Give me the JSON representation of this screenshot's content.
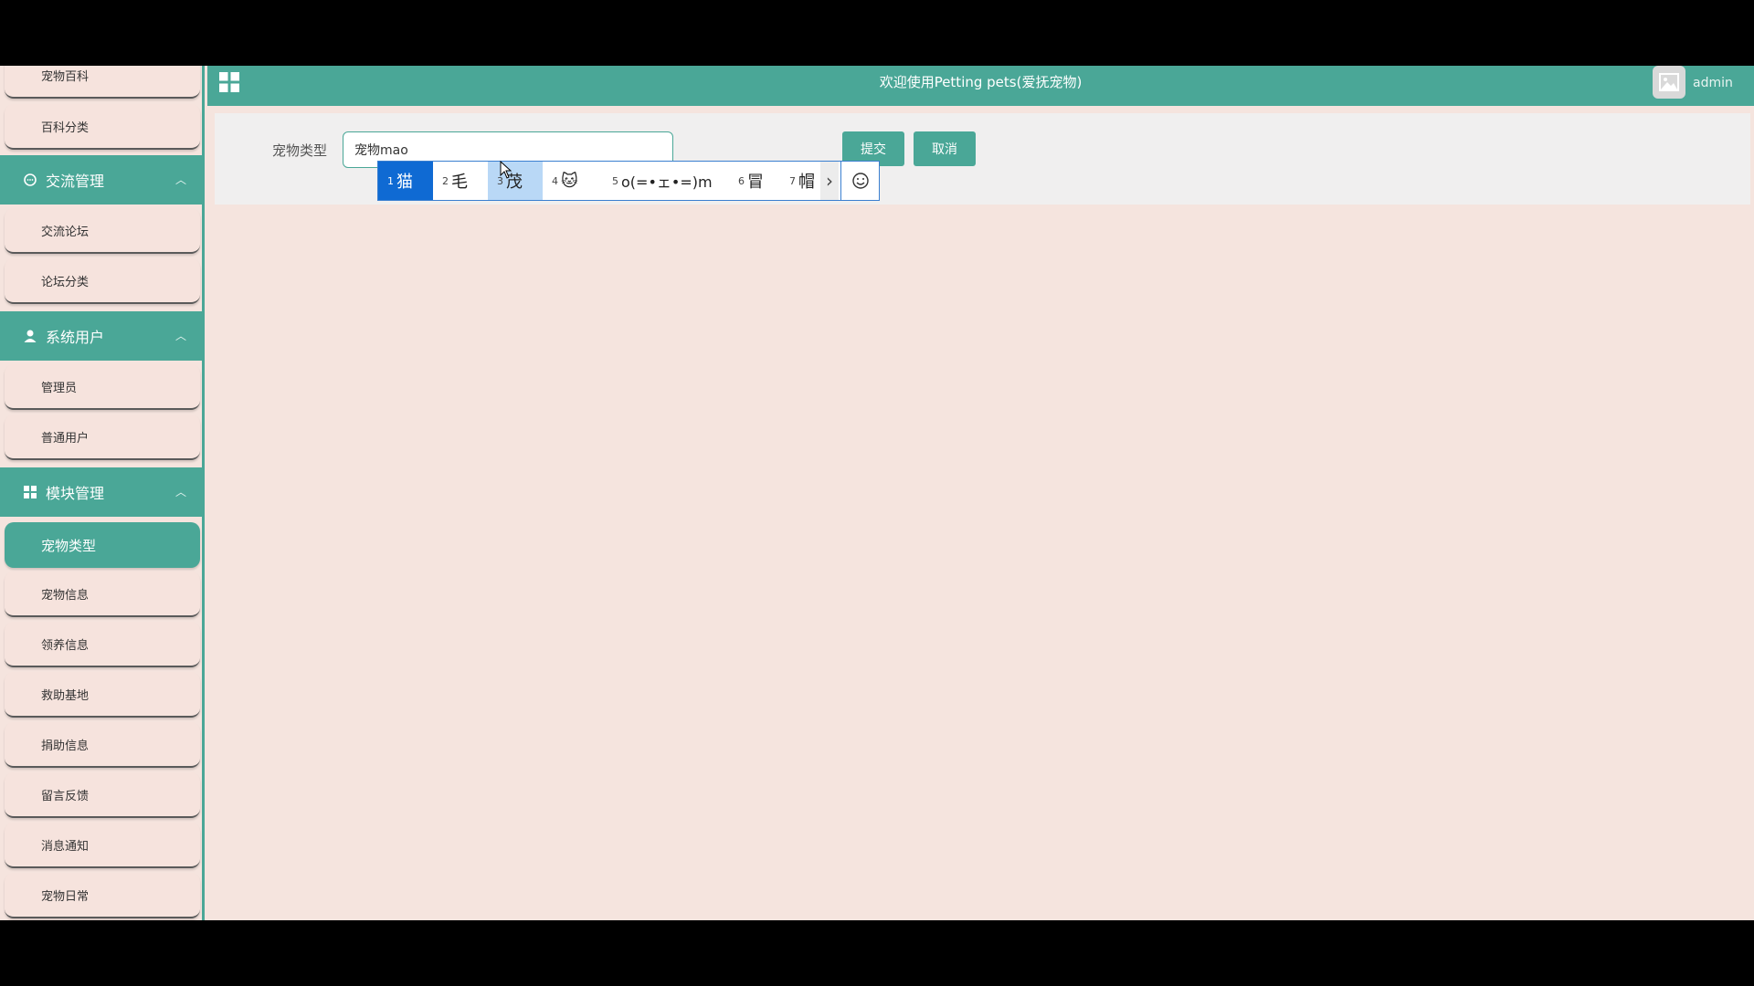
{
  "header": {
    "title": "欢迎使用Petting pets(爱抚宠物)",
    "user": "admin"
  },
  "sidebar": {
    "items_top": [
      "宠物百科",
      "百科分类"
    ],
    "groups": [
      {
        "label": "交流管理",
        "items": [
          "交流论坛",
          "论坛分类"
        ]
      },
      {
        "label": "系统用户",
        "items": [
          "管理员",
          "普通用户"
        ]
      },
      {
        "label": "模块管理",
        "items": [
          "宠物类型",
          "宠物信息",
          "领养信息",
          "救助基地",
          "捐助信息",
          "留言反馈",
          "消息通知",
          "宠物日常"
        ]
      }
    ],
    "active_item": "宠物类型"
  },
  "form": {
    "label": "宠物类型",
    "input_value": "宠物mao",
    "submit_label": "提交",
    "cancel_label": "取消"
  },
  "ime": {
    "candidates": [
      {
        "num": "1",
        "text": "猫"
      },
      {
        "num": "2",
        "text": "毛"
      },
      {
        "num": "3",
        "text": "茂"
      },
      {
        "num": "4",
        "text": "🐱"
      },
      {
        "num": "5",
        "text": "o(=•ェ•=)m"
      },
      {
        "num": "6",
        "text": "冒"
      },
      {
        "num": "7",
        "text": "帽"
      }
    ],
    "next_glyph": "›",
    "emoji_glyph": "☺"
  },
  "colors": {
    "accent": "#4aa797",
    "background": "#f5e4de",
    "ime_selected": "#0f6ad3"
  }
}
